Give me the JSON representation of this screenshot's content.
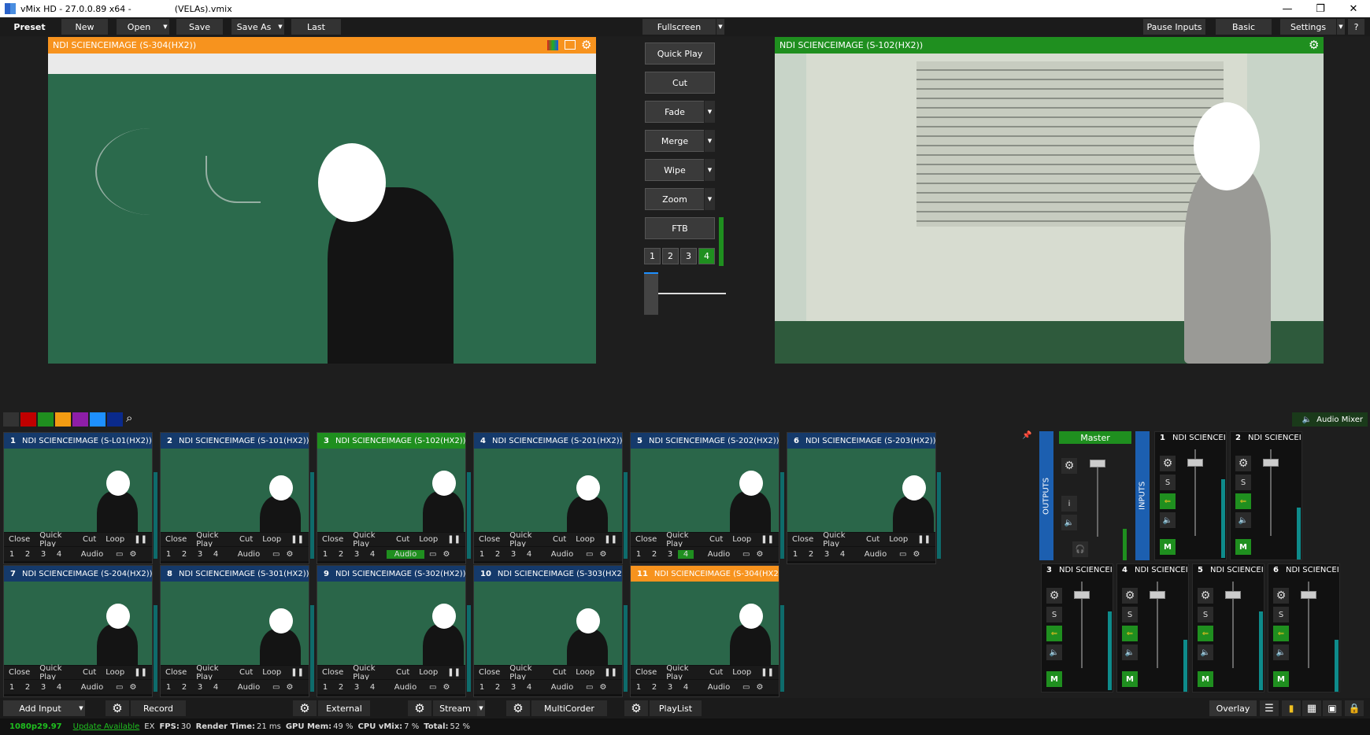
{
  "window": {
    "app_title": "vMix HD - 27.0.0.89 x64 -",
    "project": "(VELAs).vmix",
    "minimize": "—",
    "restore": "❐",
    "close": "✕"
  },
  "toolbar": {
    "preset": "Preset",
    "new": "New",
    "open": "Open",
    "save": "Save",
    "save_as": "Save As",
    "last": "Last",
    "fullscreen": "Fullscreen",
    "pause_inputs": "Pause Inputs",
    "basic": "Basic",
    "settings": "Settings",
    "help": "?"
  },
  "preview": {
    "title": "NDI SCIENCEIMAGE (S-304(HX2))"
  },
  "output": {
    "title": "NDI SCIENCEIMAGE (S-102(HX2))"
  },
  "transitions": {
    "quick_play": "Quick Play",
    "cut": "Cut",
    "fade": "Fade",
    "merge": "Merge",
    "wipe": "Wipe",
    "zoom": "Zoom",
    "ftb": "FTB",
    "numbers": [
      "1",
      "2",
      "3",
      "4"
    ],
    "active_number": "4"
  },
  "colors": {
    "preview_header": "#f7931e",
    "output_header": "#1f8f1f",
    "accent_green": "#1f8f1f",
    "input_header": "#153a6b"
  },
  "inputs_bar": {
    "audio_mixer": "Audio Mixer",
    "search_icon": "search-icon"
  },
  "tile_controls": {
    "close": "Close",
    "quick_play": "Quick Play",
    "cut": "Cut",
    "loop": "Loop",
    "pause": "❚❚",
    "audio": "Audio",
    "layers": [
      "1",
      "2",
      "3",
      "4"
    ]
  },
  "inputs": [
    {
      "num": "1",
      "name": "NDI SCIENCEIMAGE (S-L01(HX2))"
    },
    {
      "num": "2",
      "name": "NDI SCIENCEIMAGE (S-101(HX2))"
    },
    {
      "num": "3",
      "name": "NDI SCIENCEIMAGE (S-102(HX2))"
    },
    {
      "num": "4",
      "name": "NDI SCIENCEIMAGE (S-201(HX2))"
    },
    {
      "num": "5",
      "name": "NDI SCIENCEIMAGE (S-202(HX2))"
    },
    {
      "num": "6",
      "name": "NDI SCIENCEIMAGE (S-203(HX2))"
    },
    {
      "num": "7",
      "name": "NDI SCIENCEIMAGE (S-204(HX2))"
    },
    {
      "num": "8",
      "name": "NDI SCIENCEIMAGE (S-301(HX2))"
    },
    {
      "num": "9",
      "name": "NDI SCIENCEIMAGE (S-302(HX2))"
    },
    {
      "num": "10",
      "name": "NDI SCIENCEIMAGE (S-303(HX2))"
    },
    {
      "num": "11",
      "name": "NDI SCIENCEIMAGE (S-304(HX2))"
    }
  ],
  "mixer": {
    "master": "Master",
    "outputs": "OUTPUTS",
    "inputs": "INPUTS",
    "s": "S",
    "m": "M",
    "i": "i",
    "channels": [
      {
        "num": "1",
        "name": "NDI SCIENCEI"
      },
      {
        "num": "2",
        "name": "NDI SCIENCEI"
      },
      {
        "num": "3",
        "name": "NDI SCIENCEI"
      },
      {
        "num": "4",
        "name": "NDI SCIENCEI"
      },
      {
        "num": "5",
        "name": "NDI SCIENCEI"
      },
      {
        "num": "6",
        "name": "NDI SCIENCEI"
      }
    ]
  },
  "bottom": {
    "add_input": "Add Input",
    "record": "Record",
    "external": "External",
    "stream": "Stream",
    "multicorder": "MultiCorder",
    "playlist": "PlayList",
    "overlay": "Overlay"
  },
  "status": {
    "format": "1080p29.97",
    "update": "Update Available",
    "ex": "EX",
    "fps_label": "FPS:",
    "fps": "30",
    "render_label": "Render Time:",
    "render": "21 ms",
    "gpu_label": "GPU Mem:",
    "gpu": "49 %",
    "cpu_label": "CPU vMix:",
    "cpu": "7 %",
    "total_label": "Total:",
    "total": "52 %"
  }
}
